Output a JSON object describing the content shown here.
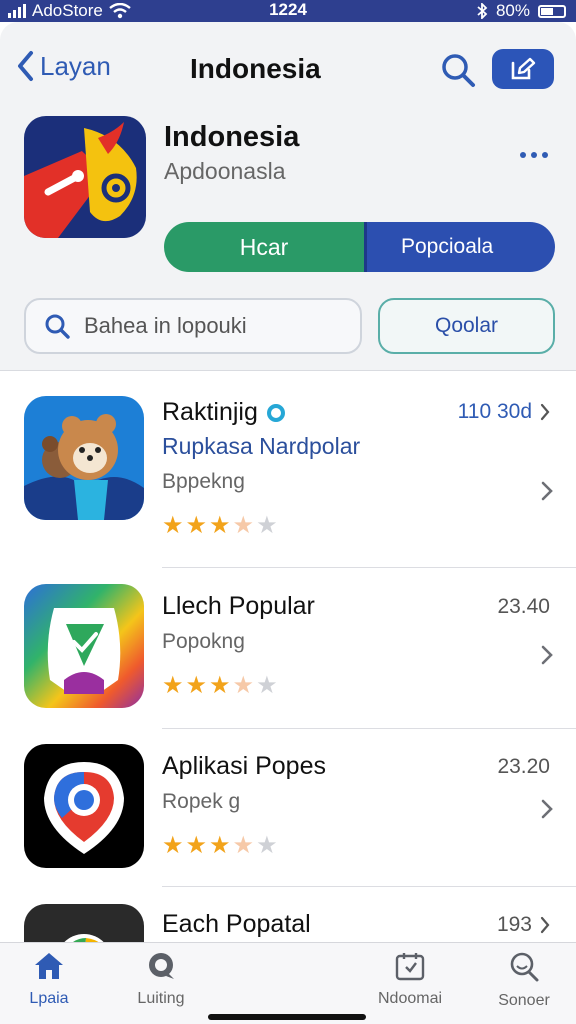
{
  "status_bar": {
    "carrier": "AdoStore",
    "time": "1224",
    "battery": "80%"
  },
  "nav": {
    "back_label": "Layan",
    "title": "Indonesia"
  },
  "hero": {
    "title": "Indonesia",
    "subtitle": "Apdoonasla",
    "segment_left": "Hcar",
    "segment_right": "Popcioala"
  },
  "search": {
    "placeholder": "Bahea in lopouki",
    "action_label": "Qoolar"
  },
  "apps": [
    {
      "name": "Raktinjig",
      "category": "Rupkasa Nardpolar",
      "subtitle": "Bppekng",
      "meta": "110 30d",
      "rating": 3.5
    },
    {
      "name": "Llech Popular",
      "subtitle": "Popokng",
      "meta": "23.40",
      "rating": 3.5
    },
    {
      "name": "Aplikasi Popes",
      "subtitle": "Ropek g",
      "meta": "23.20",
      "rating": 3.5
    },
    {
      "name": "Each Popatal",
      "meta": "193"
    }
  ],
  "tabs": [
    {
      "label": "Lpaia",
      "icon": "home-icon",
      "active": true
    },
    {
      "label": "Luiting",
      "icon": "chat-icon",
      "active": false
    },
    {
      "label": "Ndoomai",
      "icon": "apps-icon",
      "active": false
    },
    {
      "label": "Sonoer",
      "icon": "search-icon",
      "active": false
    }
  ],
  "colors": {
    "accent": "#2c55b8",
    "green": "#2a9a67",
    "star": "#f2a31b"
  }
}
